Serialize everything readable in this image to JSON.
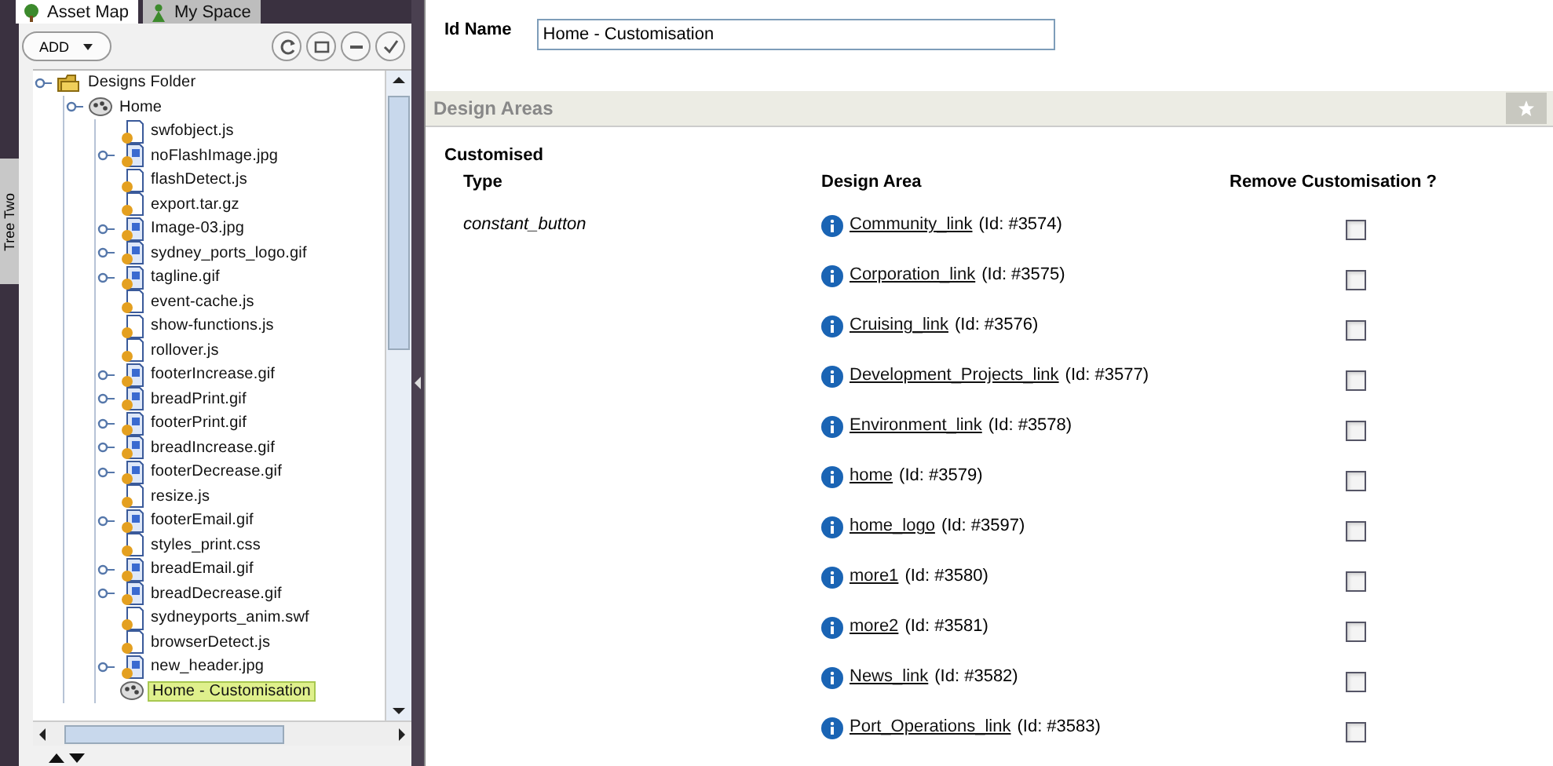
{
  "tabs": [
    {
      "label": "Asset Map",
      "selected": true
    },
    {
      "label": "My Space",
      "selected": false
    }
  ],
  "side_tab": {
    "label": "Tree Two"
  },
  "toolbar": {
    "add_button": "ADD"
  },
  "tree": [
    {
      "label": "Designs Folder",
      "kind": "folder",
      "expandable": true,
      "selected": false,
      "children": [
        {
          "label": "Home",
          "kind": "design",
          "expandable": true,
          "selected": false,
          "children": [
            {
              "label": "swfobject.js",
              "kind": "file",
              "expandable": false,
              "selected": false
            },
            {
              "label": "noFlashImage.jpg",
              "kind": "image",
              "expandable": true,
              "selected": false
            },
            {
              "label": "flashDetect.js",
              "kind": "file",
              "expandable": false,
              "selected": false
            },
            {
              "label": "export.tar.gz",
              "kind": "file",
              "expandable": false,
              "selected": false
            },
            {
              "label": "Image-03.jpg",
              "kind": "image",
              "expandable": true,
              "selected": false
            },
            {
              "label": "sydney_ports_logo.gif",
              "kind": "image",
              "expandable": true,
              "selected": false
            },
            {
              "label": "tagline.gif",
              "kind": "image",
              "expandable": true,
              "selected": false
            },
            {
              "label": "event-cache.js",
              "kind": "file",
              "expandable": false,
              "selected": false
            },
            {
              "label": "show-functions.js",
              "kind": "file",
              "expandable": false,
              "selected": false
            },
            {
              "label": "rollover.js",
              "kind": "file",
              "expandable": false,
              "selected": false
            },
            {
              "label": "footerIncrease.gif",
              "kind": "image",
              "expandable": true,
              "selected": false
            },
            {
              "label": "breadPrint.gif",
              "kind": "image",
              "expandable": true,
              "selected": false
            },
            {
              "label": "footerPrint.gif",
              "kind": "image",
              "expandable": true,
              "selected": false
            },
            {
              "label": "breadIncrease.gif",
              "kind": "image",
              "expandable": true,
              "selected": false
            },
            {
              "label": "footerDecrease.gif",
              "kind": "image",
              "expandable": true,
              "selected": false
            },
            {
              "label": "resize.js",
              "kind": "file",
              "expandable": false,
              "selected": false
            },
            {
              "label": "footerEmail.gif",
              "kind": "image",
              "expandable": true,
              "selected": false
            },
            {
              "label": "styles_print.css",
              "kind": "file",
              "expandable": false,
              "selected": false
            },
            {
              "label": "breadEmail.gif",
              "kind": "image",
              "expandable": true,
              "selected": false
            },
            {
              "label": "breadDecrease.gif",
              "kind": "image",
              "expandable": true,
              "selected": false
            },
            {
              "label": "sydneyports_anim.swf",
              "kind": "file",
              "expandable": false,
              "selected": false
            },
            {
              "label": "browserDetect.js",
              "kind": "file",
              "expandable": false,
              "selected": false
            },
            {
              "label": "new_header.jpg",
              "kind": "image",
              "expandable": true,
              "selected": false
            },
            {
              "label": "Home - Customisation",
              "kind": "design",
              "expandable": false,
              "selected": true
            }
          ]
        }
      ]
    }
  ],
  "id_name": {
    "label": "Id Name",
    "value": "Home - Customisation"
  },
  "section": {
    "title": "Design Areas"
  },
  "customised": {
    "heading": "Customised",
    "columns": [
      "Type",
      "Design Area",
      "Remove Customisation ?"
    ],
    "type": "constant_button",
    "rows": [
      {
        "link": "Community_link",
        "id": "(Id: #3574)",
        "checked": false
      },
      {
        "link": "Corporation_link",
        "id": "(Id: #3575)",
        "checked": false
      },
      {
        "link": "Cruising_link",
        "id": "(Id: #3576)",
        "checked": false
      },
      {
        "link": "Development_Projects_link",
        "id": "(Id: #3577)",
        "checked": false
      },
      {
        "link": "Environment_link",
        "id": "(Id: #3578)",
        "checked": false
      },
      {
        "link": "home",
        "id": "(Id: #3579)",
        "checked": false
      },
      {
        "link": "home_logo",
        "id": "(Id: #3597)",
        "checked": false
      },
      {
        "link": "more1",
        "id": "(Id: #3580)",
        "checked": false
      },
      {
        "link": "more2",
        "id": "(Id: #3581)",
        "checked": false
      },
      {
        "link": "News_link",
        "id": "(Id: #3582)",
        "checked": false
      },
      {
        "link": "Port_Operations_link",
        "id": "(Id: #3583)",
        "checked": false
      }
    ]
  }
}
